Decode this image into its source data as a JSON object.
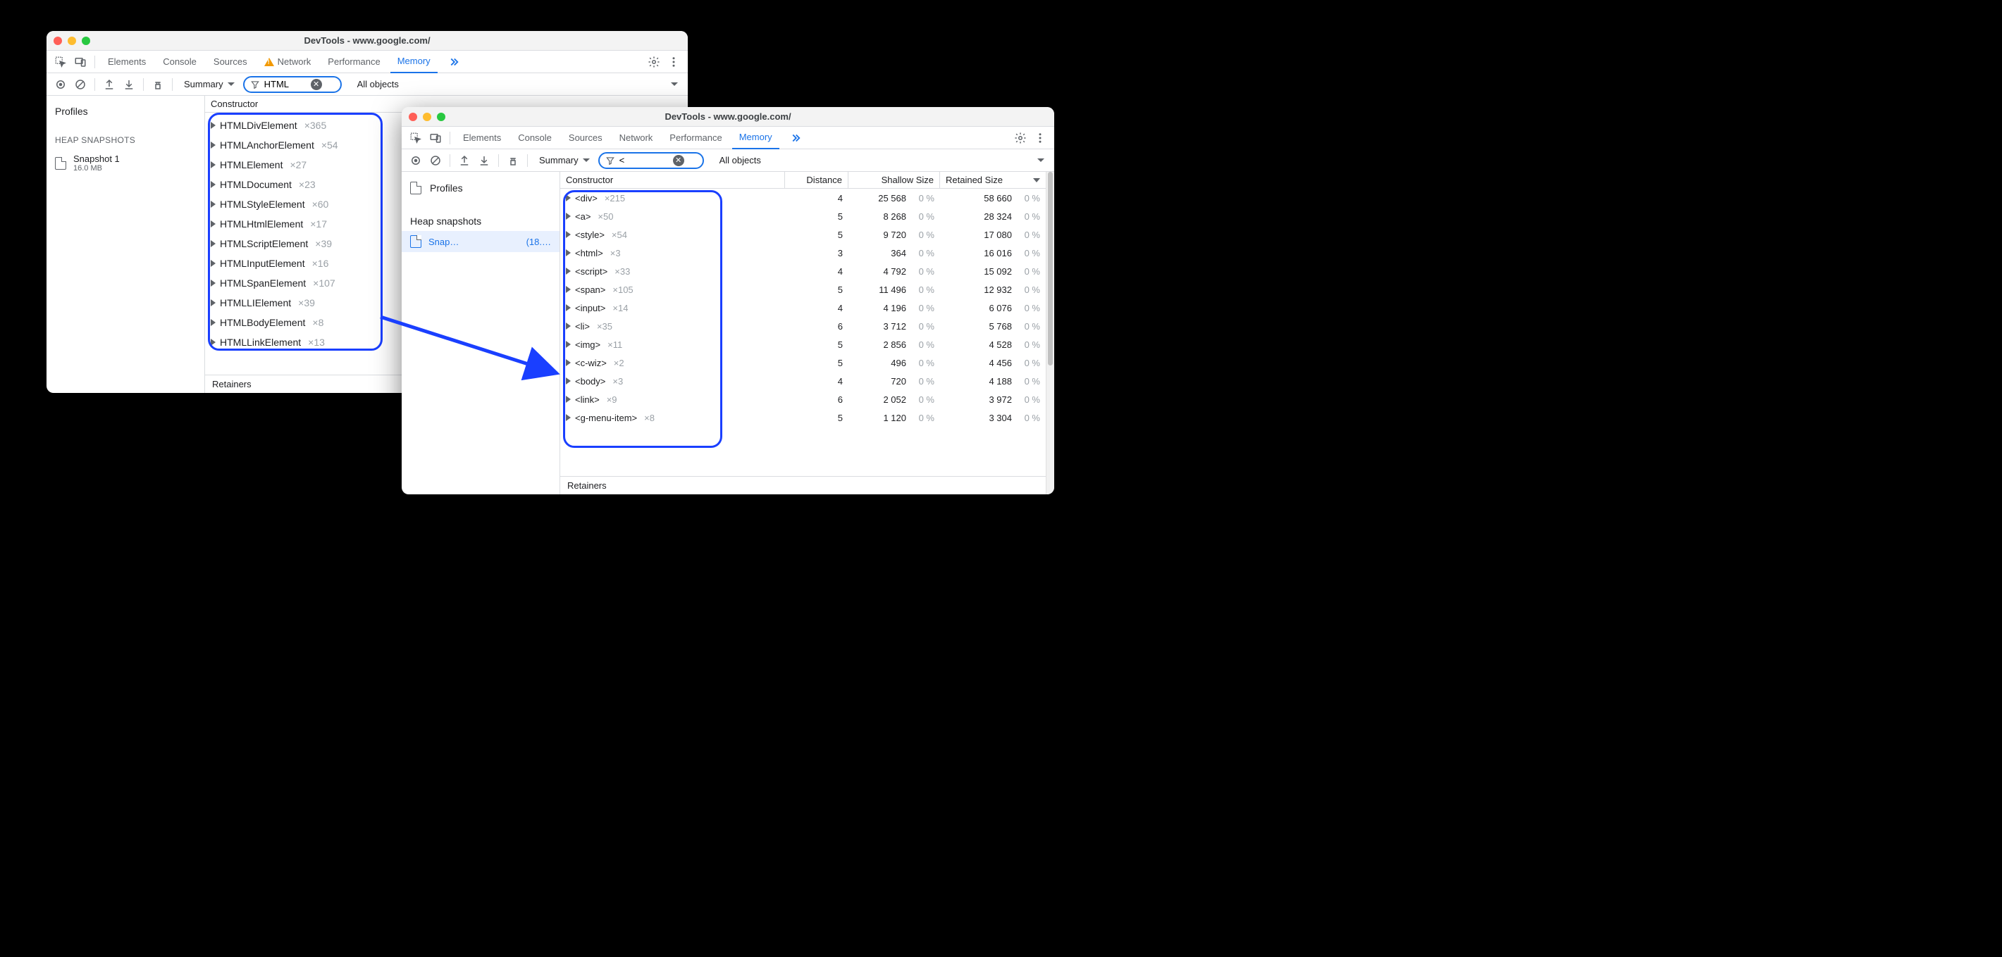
{
  "window1": {
    "title": "DevTools - www.google.com/",
    "tabs": [
      "Elements",
      "Console",
      "Sources",
      "Network",
      "Performance",
      "Memory"
    ],
    "active_tab": "Memory",
    "network_warning": true,
    "toolbar": {
      "view": "Summary",
      "filter": "HTML",
      "scope": "All objects"
    },
    "sidebar": {
      "title": "Profiles",
      "section": "HEAP SNAPSHOTS",
      "snapshot_name": "Snapshot 1",
      "snapshot_size": "16.0 MB"
    },
    "header": "Constructor",
    "rows": [
      {
        "name": "HTMLDivElement",
        "count": "×365"
      },
      {
        "name": "HTMLAnchorElement",
        "count": "×54"
      },
      {
        "name": "HTMLElement",
        "count": "×27"
      },
      {
        "name": "HTMLDocument",
        "count": "×23"
      },
      {
        "name": "HTMLStyleElement",
        "count": "×60"
      },
      {
        "name": "HTMLHtmlElement",
        "count": "×17"
      },
      {
        "name": "HTMLScriptElement",
        "count": "×39"
      },
      {
        "name": "HTMLInputElement",
        "count": "×16"
      },
      {
        "name": "HTMLSpanElement",
        "count": "×107"
      },
      {
        "name": "HTMLLIElement",
        "count": "×39"
      },
      {
        "name": "HTMLBodyElement",
        "count": "×8"
      },
      {
        "name": "HTMLLinkElement",
        "count": "×13"
      }
    ],
    "footer": "Retainers"
  },
  "window2": {
    "title": "DevTools - www.google.com/",
    "tabs": [
      "Elements",
      "Console",
      "Sources",
      "Network",
      "Performance",
      "Memory"
    ],
    "active_tab": "Memory",
    "toolbar": {
      "view": "Summary",
      "filter": "<",
      "scope": "All objects"
    },
    "sidebar": {
      "title": "Profiles",
      "section": "Heap snapshots",
      "snapshot_name": "Snap…",
      "snapshot_size": "(18.…"
    },
    "columns": [
      "Constructor",
      "Distance",
      "Shallow Size",
      "Retained Size"
    ],
    "rows": [
      {
        "name": "<div>",
        "count": "×215",
        "distance": "4",
        "shallow": "25 568",
        "shallow_pct": "0 %",
        "retained": "58 660",
        "retained_pct": "0 %"
      },
      {
        "name": "<a>",
        "count": "×50",
        "distance": "5",
        "shallow": "8 268",
        "shallow_pct": "0 %",
        "retained": "28 324",
        "retained_pct": "0 %"
      },
      {
        "name": "<style>",
        "count": "×54",
        "distance": "5",
        "shallow": "9 720",
        "shallow_pct": "0 %",
        "retained": "17 080",
        "retained_pct": "0 %"
      },
      {
        "name": "<html>",
        "count": "×3",
        "distance": "3",
        "shallow": "364",
        "shallow_pct": "0 %",
        "retained": "16 016",
        "retained_pct": "0 %"
      },
      {
        "name": "<script>",
        "count": "×33",
        "distance": "4",
        "shallow": "4 792",
        "shallow_pct": "0 %",
        "retained": "15 092",
        "retained_pct": "0 %"
      },
      {
        "name": "<span>",
        "count": "×105",
        "distance": "5",
        "shallow": "11 496",
        "shallow_pct": "0 %",
        "retained": "12 932",
        "retained_pct": "0 %"
      },
      {
        "name": "<input>",
        "count": "×14",
        "distance": "4",
        "shallow": "4 196",
        "shallow_pct": "0 %",
        "retained": "6 076",
        "retained_pct": "0 %"
      },
      {
        "name": "<li>",
        "count": "×35",
        "distance": "6",
        "shallow": "3 712",
        "shallow_pct": "0 %",
        "retained": "5 768",
        "retained_pct": "0 %"
      },
      {
        "name": "<img>",
        "count": "×11",
        "distance": "5",
        "shallow": "2 856",
        "shallow_pct": "0 %",
        "retained": "4 528",
        "retained_pct": "0 %"
      },
      {
        "name": "<c-wiz>",
        "count": "×2",
        "distance": "5",
        "shallow": "496",
        "shallow_pct": "0 %",
        "retained": "4 456",
        "retained_pct": "0 %"
      },
      {
        "name": "<body>",
        "count": "×3",
        "distance": "4",
        "shallow": "720",
        "shallow_pct": "0 %",
        "retained": "4 188",
        "retained_pct": "0 %"
      },
      {
        "name": "<link>",
        "count": "×9",
        "distance": "6",
        "shallow": "2 052",
        "shallow_pct": "0 %",
        "retained": "3 972",
        "retained_pct": "0 %"
      },
      {
        "name": "<g-menu-item>",
        "count": "×8",
        "distance": "5",
        "shallow": "1 120",
        "shallow_pct": "0 %",
        "retained": "3 304",
        "retained_pct": "0 %"
      }
    ],
    "footer": "Retainers"
  }
}
